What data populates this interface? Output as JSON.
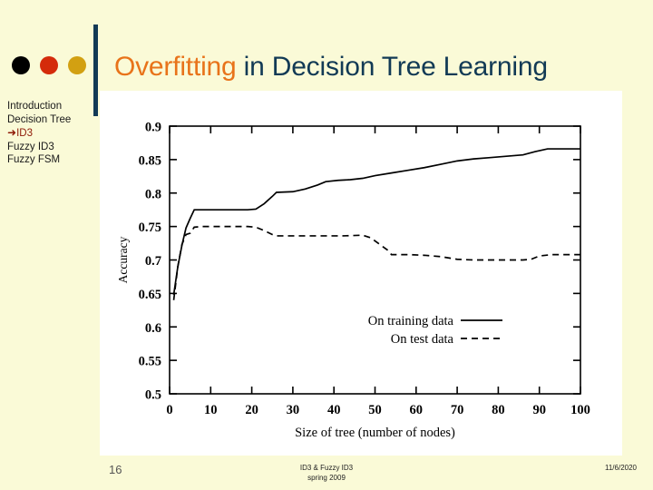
{
  "slide": {
    "title_accent": "Overfitting",
    "title_rest": " in Decision Tree Learning",
    "background_color": "#FAFAD7",
    "panel_color": "#FFFFFF"
  },
  "bullets": [
    {
      "name": "bullet-dot-black",
      "color": "#000000"
    },
    {
      "name": "bullet-dot-red",
      "color": "#D42B0B"
    },
    {
      "name": "bullet-dot-gold",
      "color": "#D2A012"
    }
  ],
  "sidebar": {
    "items": [
      {
        "label": "Introduction",
        "current": false,
        "arrow": ""
      },
      {
        "label": "Decision  Tree",
        "current": false,
        "arrow": ""
      },
      {
        "label": "ID3",
        "current": true,
        "arrow": "➜"
      },
      {
        "label": "Fuzzy ID3",
        "current": false,
        "arrow": ""
      },
      {
        "label": "Fuzzy  FSM",
        "current": false,
        "arrow": ""
      }
    ]
  },
  "footer": {
    "slide_number": "16",
    "center_line1": "ID3 & Fuzzy ID3",
    "center_line2": "spring 2009",
    "date": "11/6/2020"
  },
  "chart_data": {
    "type": "line",
    "title": "",
    "xlabel": "Size of tree (number of nodes)",
    "ylabel": "Accuracy",
    "xlim": [
      0,
      100
    ],
    "ylim": [
      0.5,
      0.9
    ],
    "xticks": [
      0,
      10,
      20,
      30,
      40,
      50,
      60,
      70,
      80,
      90,
      100
    ],
    "xticklabels": [
      "0",
      "10",
      "20",
      "30",
      "40",
      "50",
      "60",
      "70",
      "80",
      "90",
      "100"
    ],
    "yticks": [
      0.5,
      0.55,
      0.6,
      0.65,
      0.7,
      0.75,
      0.8,
      0.85,
      0.9
    ],
    "yticklabels": [
      "0.5",
      "0.55",
      "0.6",
      "0.65",
      "0.7",
      "0.75",
      "0.8",
      "0.85",
      "0.9"
    ],
    "grid": false,
    "legend_position": "center-right",
    "legend": [
      {
        "name": "On training data",
        "style": "solid",
        "color": "#000000"
      },
      {
        "name": "On test data",
        "style": "dashed",
        "color": "#000000"
      }
    ],
    "series": [
      {
        "name": "On training data",
        "style": "solid",
        "color": "#000000",
        "points": [
          [
            1,
            0.648
          ],
          [
            2,
            0.69
          ],
          [
            3,
            0.722
          ],
          [
            4,
            0.748
          ],
          [
            5,
            0.762
          ],
          [
            6,
            0.775
          ],
          [
            8,
            0.775
          ],
          [
            12,
            0.775
          ],
          [
            16,
            0.775
          ],
          [
            19,
            0.775
          ],
          [
            21,
            0.776
          ],
          [
            23,
            0.784
          ],
          [
            25,
            0.795
          ],
          [
            26,
            0.801
          ],
          [
            30,
            0.802
          ],
          [
            33,
            0.806
          ],
          [
            36,
            0.812
          ],
          [
            38,
            0.817
          ],
          [
            41,
            0.819
          ],
          [
            44,
            0.82
          ],
          [
            47,
            0.822
          ],
          [
            50,
            0.826
          ],
          [
            54,
            0.83
          ],
          [
            58,
            0.834
          ],
          [
            62,
            0.838
          ],
          [
            66,
            0.843
          ],
          [
            70,
            0.848
          ],
          [
            74,
            0.851
          ],
          [
            78,
            0.853
          ],
          [
            82,
            0.855
          ],
          [
            86,
            0.857
          ],
          [
            89,
            0.862
          ],
          [
            92,
            0.866
          ],
          [
            96,
            0.866
          ],
          [
            100,
            0.866
          ]
        ]
      },
      {
        "name": "On test data",
        "style": "dashed",
        "color": "#000000",
        "points": [
          [
            1,
            0.64
          ],
          [
            2,
            0.69
          ],
          [
            3,
            0.723
          ],
          [
            4,
            0.738
          ],
          [
            5,
            0.74
          ],
          [
            6,
            0.749
          ],
          [
            8,
            0.75
          ],
          [
            12,
            0.75
          ],
          [
            16,
            0.75
          ],
          [
            19,
            0.75
          ],
          [
            21,
            0.749
          ],
          [
            23,
            0.744
          ],
          [
            25,
            0.738
          ],
          [
            26,
            0.736
          ],
          [
            30,
            0.736
          ],
          [
            36,
            0.736
          ],
          [
            42,
            0.736
          ],
          [
            47,
            0.737
          ],
          [
            49,
            0.733
          ],
          [
            51,
            0.724
          ],
          [
            53,
            0.715
          ],
          [
            54,
            0.708
          ],
          [
            58,
            0.708
          ],
          [
            62,
            0.707
          ],
          [
            66,
            0.705
          ],
          [
            70,
            0.701
          ],
          [
            74,
            0.7
          ],
          [
            78,
            0.7
          ],
          [
            82,
            0.7
          ],
          [
            86,
            0.7
          ],
          [
            88,
            0.701
          ],
          [
            90,
            0.706
          ],
          [
            93,
            0.708
          ],
          [
            96,
            0.708
          ],
          [
            100,
            0.708
          ]
        ]
      }
    ]
  }
}
